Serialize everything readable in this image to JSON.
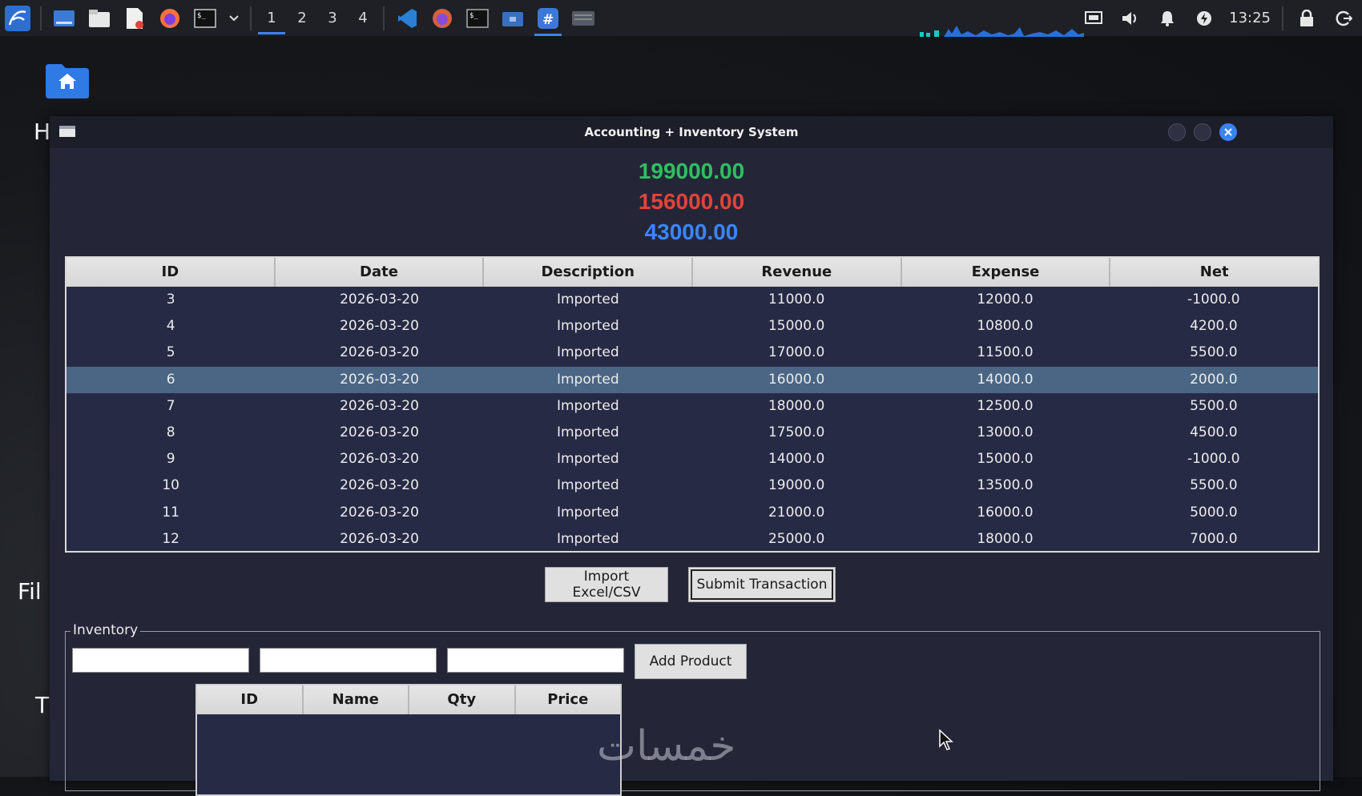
{
  "taskbar": {
    "workspaces": [
      "1",
      "2",
      "3",
      "4"
    ],
    "active_workspace": "1",
    "clock": "13:25"
  },
  "desktop": {
    "labels": [
      "H",
      "Fil",
      "T"
    ]
  },
  "window": {
    "title": "Accounting + Inventory System",
    "totals": {
      "revenue": "199000.00",
      "expense": "156000.00",
      "net": "43000.00"
    },
    "colors": {
      "revenue": "#2fbf60",
      "expense": "#e0443a",
      "net": "#3a86ff",
      "selected_row": "#4a6684"
    },
    "transactions": {
      "columns": [
        "ID",
        "Date",
        "Description",
        "Revenue",
        "Expense",
        "Net"
      ],
      "rows": [
        [
          "3",
          "2026-03-20",
          "Imported",
          "11000.0",
          "12000.0",
          "-1000.0"
        ],
        [
          "4",
          "2026-03-20",
          "Imported",
          "15000.0",
          "10800.0",
          "4200.0"
        ],
        [
          "5",
          "2026-03-20",
          "Imported",
          "17000.0",
          "11500.0",
          "5500.0"
        ],
        [
          "6",
          "2026-03-20",
          "Imported",
          "16000.0",
          "14000.0",
          "2000.0"
        ],
        [
          "7",
          "2026-03-20",
          "Imported",
          "18000.0",
          "12500.0",
          "5500.0"
        ],
        [
          "8",
          "2026-03-20",
          "Imported",
          "17500.0",
          "13000.0",
          "4500.0"
        ],
        [
          "9",
          "2026-03-20",
          "Imported",
          "14000.0",
          "15000.0",
          "-1000.0"
        ],
        [
          "10",
          "2026-03-20",
          "Imported",
          "19000.0",
          "13500.0",
          "5500.0"
        ],
        [
          "11",
          "2026-03-20",
          "Imported",
          "21000.0",
          "16000.0",
          "5000.0"
        ],
        [
          "12",
          "2026-03-20",
          "Imported",
          "25000.0",
          "18000.0",
          "7000.0"
        ]
      ],
      "selected_row_id": "6"
    },
    "buttons": {
      "import": "Import Excel/CSV",
      "submit": "Submit Transaction",
      "add_product": "Add Product"
    },
    "inventory": {
      "legend": "Inventory",
      "inputs": [
        "",
        "",
        ""
      ],
      "columns": [
        "ID",
        "Name",
        "Qty",
        "Price"
      ],
      "rows": []
    }
  },
  "watermark": "خمسات"
}
